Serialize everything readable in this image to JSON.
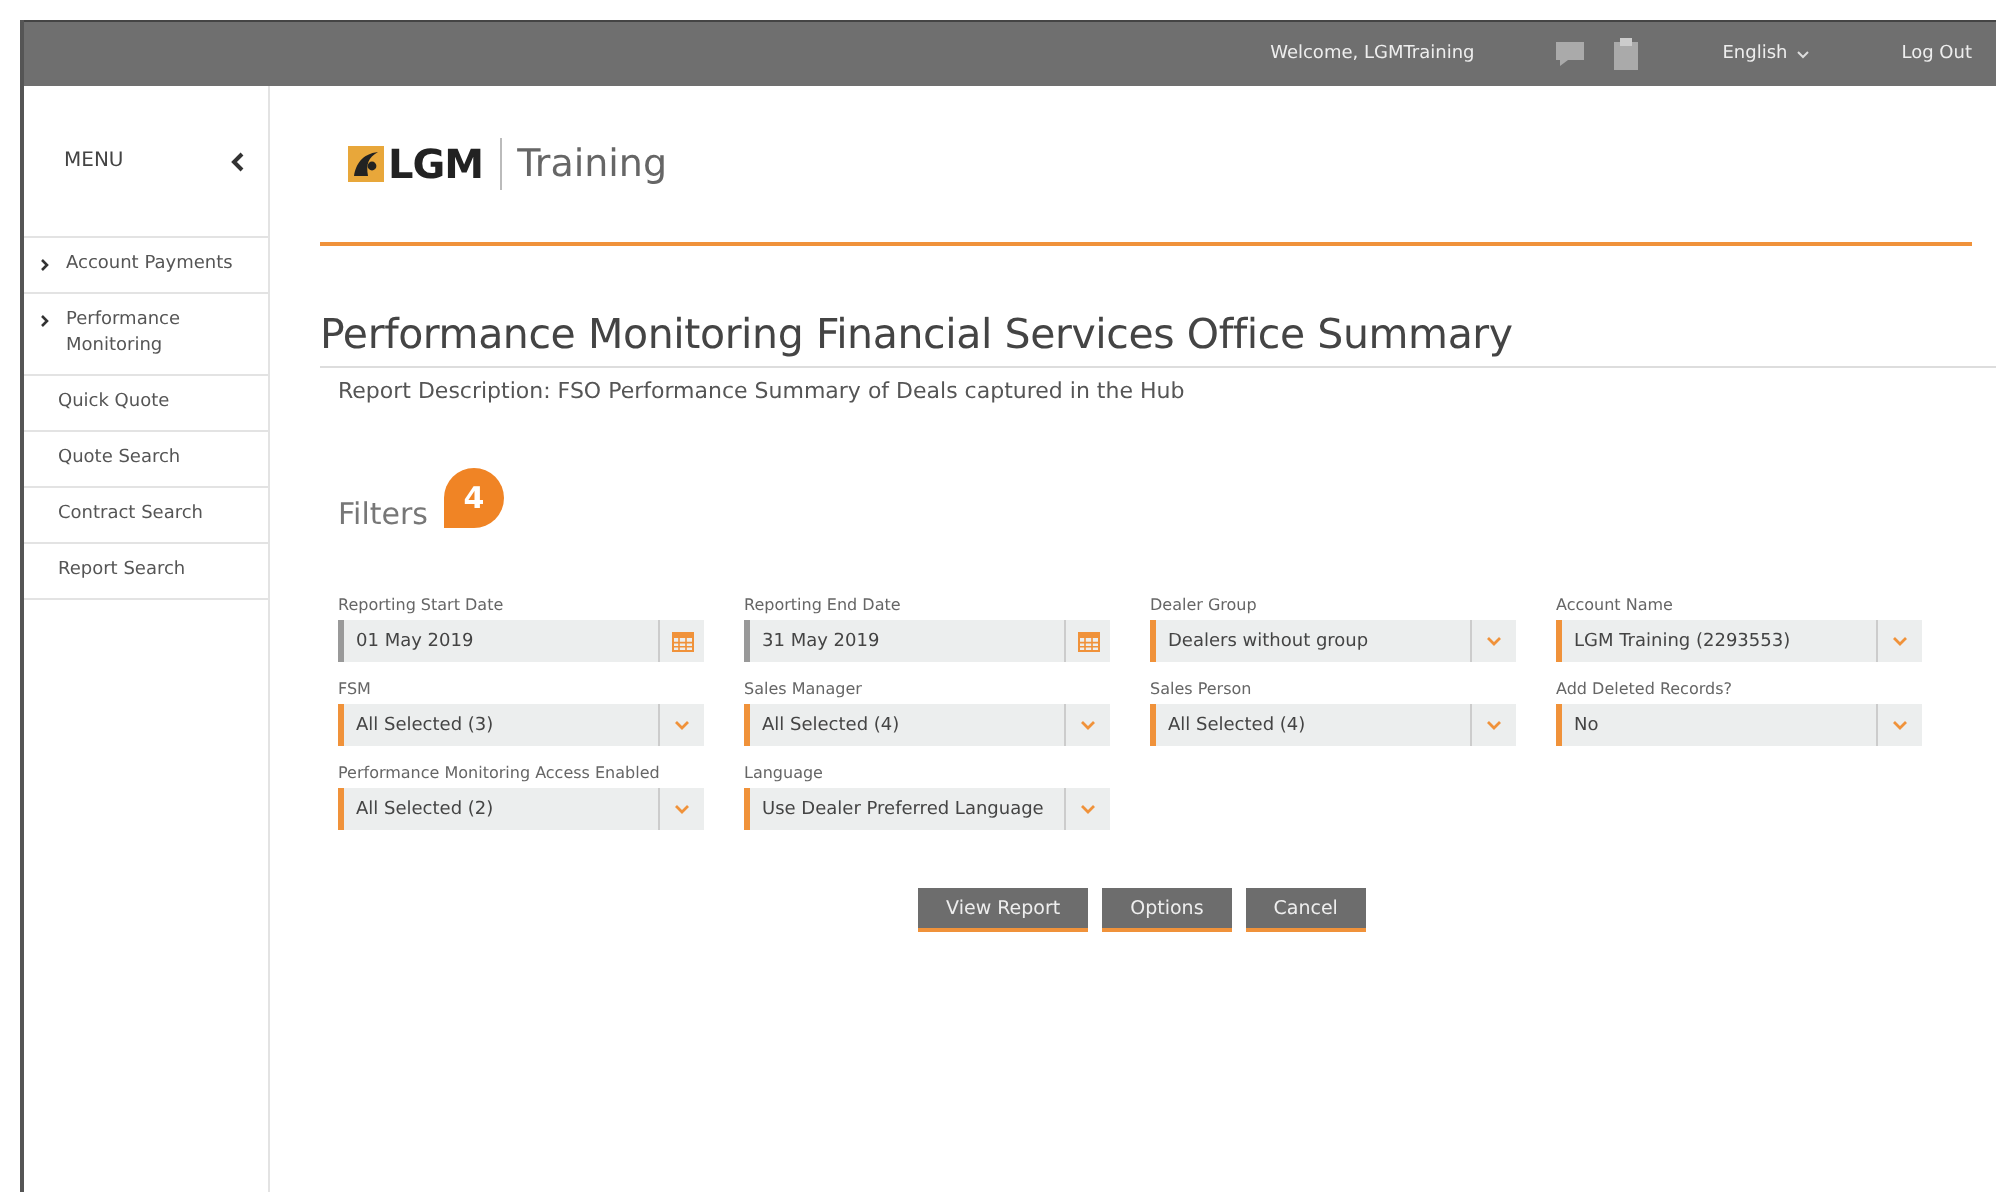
{
  "top_bar": {
    "welcome": "Welcome, LGMTraining",
    "language": "English",
    "logout": "Log Out"
  },
  "sidebar": {
    "title": "MENU",
    "items": [
      {
        "label": "Account Payments",
        "expandable": true
      },
      {
        "label": "Performance Monitoring",
        "expandable": true
      },
      {
        "label": "Quick Quote",
        "expandable": false
      },
      {
        "label": "Quote Search",
        "expandable": false
      },
      {
        "label": "Contract Search",
        "expandable": false
      },
      {
        "label": "Report Search",
        "expandable": false
      }
    ]
  },
  "logo": {
    "brand": "LGM",
    "product": "Training"
  },
  "page": {
    "title": "Performance Monitoring Financial Services Office Summary",
    "description": "Report Description: FSO Performance Summary of Deals captured in the Hub"
  },
  "filters": {
    "title": "Filters",
    "badge": "4",
    "fields": [
      {
        "label": "Reporting Start Date",
        "value": "01 May 2019",
        "kind": "date"
      },
      {
        "label": "Reporting End Date",
        "value": "31 May 2019",
        "kind": "date"
      },
      {
        "label": "Dealer Group",
        "value": "Dealers without group",
        "kind": "select"
      },
      {
        "label": "Account Name",
        "value": "LGM Training (2293553)",
        "kind": "select"
      },
      {
        "label": "FSM",
        "value": "All Selected (3)",
        "kind": "select"
      },
      {
        "label": "Sales Manager",
        "value": "All Selected (4)",
        "kind": "select"
      },
      {
        "label": "Sales Person",
        "value": "All Selected (4)",
        "kind": "select"
      },
      {
        "label": "Add Deleted Records?",
        "value": "No",
        "kind": "select"
      },
      {
        "label": "Performance Monitoring Access Enabled",
        "value": "All Selected (2)",
        "kind": "select"
      },
      {
        "label": "Language",
        "value": "Use Dealer Preferred Language",
        "kind": "select"
      }
    ]
  },
  "buttons": [
    "View Report",
    "Options",
    "Cancel"
  ]
}
